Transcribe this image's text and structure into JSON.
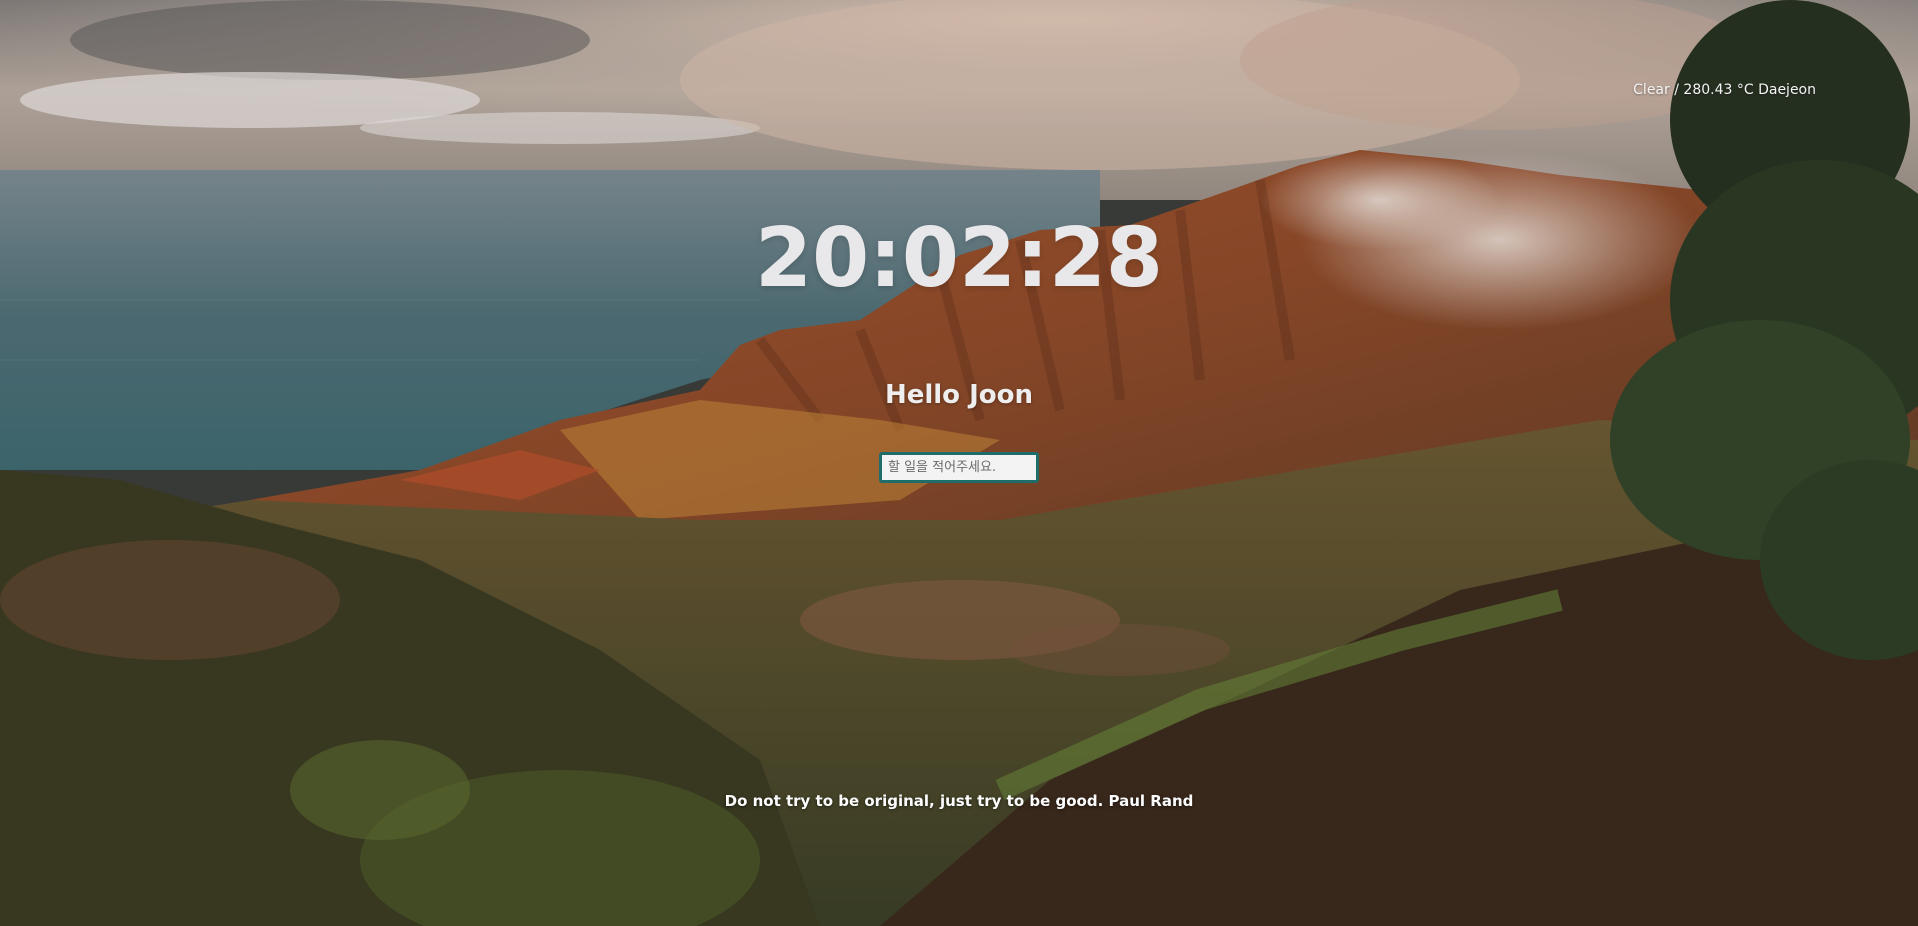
{
  "weather": {
    "condition": "Clear",
    "separator": " / ",
    "temperature": "280.43 °C",
    "city": "Daejeon"
  },
  "clock": {
    "time": "20:02:28"
  },
  "greeting": {
    "text": "Hello Joon"
  },
  "todo": {
    "placeholder": "할 일을 적어주세요.",
    "value": ""
  },
  "quote": {
    "text": "Do not try to be original, just try to be good.",
    "author": "Paul Rand"
  },
  "colors": {
    "input_border": "#1f6d6a",
    "clock_text": "#e8e8ea",
    "text": "#ffffff"
  },
  "background": {
    "description_icon": "landscape-photo"
  }
}
